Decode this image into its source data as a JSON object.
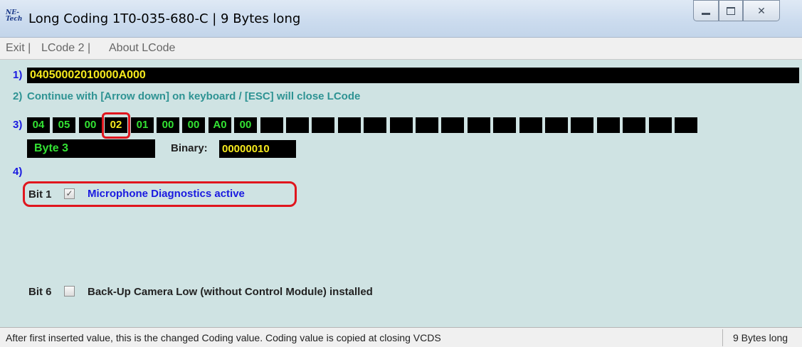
{
  "window": {
    "logo_text": "NE-Tech",
    "title": "Long Coding  1T0-035-680-C | 9 Bytes long",
    "controls": {
      "minimize_icon": "minimize-icon",
      "maximize_icon": "maximize-icon",
      "close_icon": "close-icon"
    }
  },
  "menu": {
    "items": [
      {
        "label": "Exit |"
      },
      {
        "label": "LCode 2 |"
      },
      {
        "label": "About LCode"
      }
    ]
  },
  "step1": {
    "label": "1)",
    "coding_value": "04050002010000A000"
  },
  "step2": {
    "label": "2)",
    "hint": "Continue with [Arrow down] on keyboard / [ESC] will close LCode"
  },
  "step3": {
    "label": "3)",
    "bytes": [
      "04",
      "05",
      "00",
      "02",
      "01",
      "00",
      "00",
      "A0",
      "00",
      "",
      "",
      "",
      "",
      "",
      "",
      "",
      "",
      "",
      "",
      "",
      "",
      "",
      "",
      "",
      "",
      ""
    ],
    "selected_index": 3,
    "byte_label": "Byte 3",
    "binary_label": "Binary:",
    "binary_value": "00000010"
  },
  "step4": {
    "label": "4)",
    "bits": [
      {
        "label": "Bit 1",
        "checked": true,
        "description": "Microphone Diagnostics active",
        "color": "#1a1ae0"
      },
      {
        "label": "Bit 6",
        "checked": false,
        "description": "Back-Up Camera Low (without Control Module) installed",
        "color": "#222222"
      }
    ]
  },
  "status": {
    "text": "After first inserted value, this is the changed Coding value.  Coding value is copied at closing VCDS",
    "right": "9 Bytes long"
  },
  "colors": {
    "background": "#cfe3e3",
    "accent_red": "#e0161e",
    "byte_green": "#33e233",
    "value_yellow": "#f6ea1d"
  }
}
